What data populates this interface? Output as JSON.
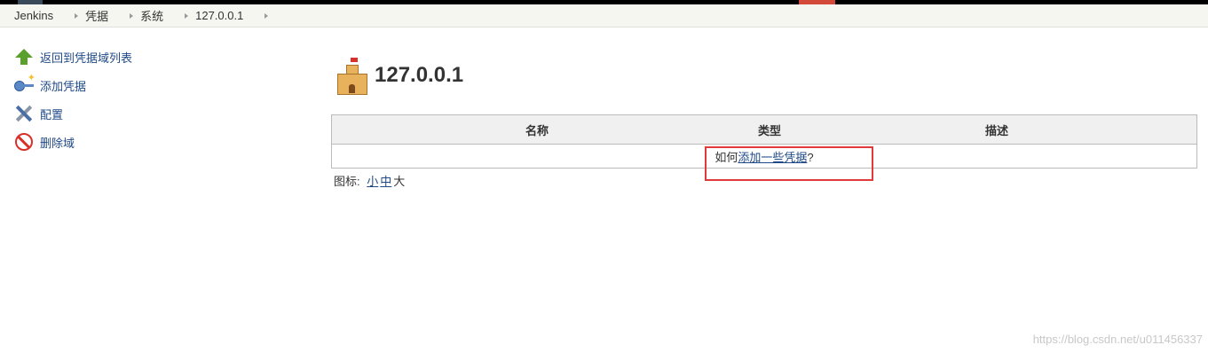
{
  "breadcrumbs": [
    "Jenkins",
    "凭据",
    "系统",
    "127.0.0.1"
  ],
  "sidebar": {
    "items": [
      {
        "label": "返回到凭据域列表",
        "icon": "arrow-up-icon"
      },
      {
        "label": "添加凭据",
        "icon": "key-icon"
      },
      {
        "label": "配置",
        "icon": "tools-icon"
      },
      {
        "label": "删除域",
        "icon": "no-entry-icon"
      }
    ]
  },
  "main": {
    "title": "127.0.0.1",
    "table": {
      "headers": [
        "名称",
        "类型",
        "描述"
      ],
      "empty_prefix": "如何",
      "empty_link": "添加一些凭据",
      "empty_suffix": "?"
    },
    "icon_size": {
      "label": "图标:",
      "small": "小",
      "medium": "中",
      "large": "大"
    }
  },
  "watermark": "https://blog.csdn.net/u011456337",
  "colors": {
    "link": "#204a87",
    "highlight": "#e03a3a",
    "accent": "#d24939"
  }
}
